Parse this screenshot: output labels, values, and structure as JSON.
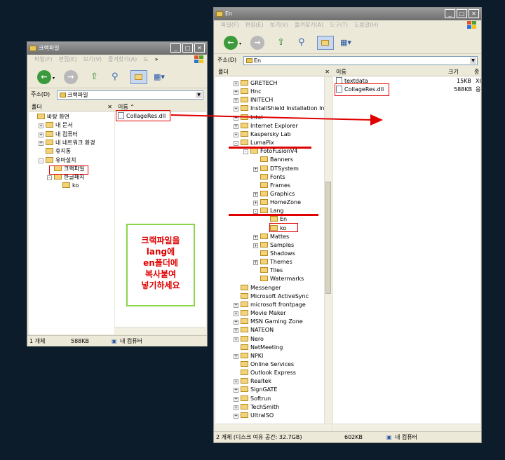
{
  "left_window": {
    "title": "크랙파일",
    "menu": [
      "파일(F)",
      "편집(E)",
      "보기(V)",
      "즐겨찾기(A)",
      "도"
    ],
    "menu_more": "»",
    "address_label": "주소(D)",
    "address_value": "크랙파일",
    "folders_header": "폴더",
    "list_header": "이름",
    "tree": [
      {
        "label": "바탕 화면",
        "indent": 0,
        "pm": ""
      },
      {
        "label": "내 문서",
        "indent": 1,
        "pm": "+"
      },
      {
        "label": "내 컴퓨터",
        "indent": 1,
        "pm": "+"
      },
      {
        "label": "내 네트워크 환경",
        "indent": 1,
        "pm": "+"
      },
      {
        "label": "휴지통",
        "indent": 1,
        "pm": ""
      },
      {
        "label": "유마설치",
        "indent": 1,
        "pm": "-"
      },
      {
        "label": "크랙파일",
        "indent": 2,
        "pm": ""
      },
      {
        "label": "한글패치",
        "indent": 2,
        "pm": "-"
      },
      {
        "label": "ko",
        "indent": 3,
        "pm": ""
      }
    ],
    "file": "CollageRes.dll",
    "status_count": "1 개체",
    "status_size": "588KB",
    "status_location": "내 컴퓨터",
    "note": "크랙파일을\nlang에\nen폴더에\n복사붙여\n넣기하세요"
  },
  "right_window": {
    "title": "En",
    "menu": [
      "파일(F)",
      "편집(E)",
      "보기(V)",
      "즐겨찾기(A)",
      "도구(T)",
      "도움말(H)"
    ],
    "address_label": "주소(D)",
    "address_value": "En",
    "folders_header": "폴더",
    "col_name": "이름",
    "col_size": "크기",
    "col_type": "종",
    "files": [
      {
        "name": "textdata",
        "size": "15KB",
        "type": "XM"
      },
      {
        "name": "CollageRes.dll",
        "size": "588KB",
        "type": "응"
      }
    ],
    "tree": [
      {
        "label": "GRETECH",
        "indent": 0,
        "pm": "+"
      },
      {
        "label": "Hnc",
        "indent": 0,
        "pm": "+"
      },
      {
        "label": "INITECH",
        "indent": 0,
        "pm": "+"
      },
      {
        "label": "InstallShield Installation Inform",
        "indent": 0,
        "pm": "+"
      },
      {
        "label": "Intel",
        "indent": 0,
        "pm": "+"
      },
      {
        "label": "Internet Explorer",
        "indent": 0,
        "pm": "+"
      },
      {
        "label": "Kaspersky Lab",
        "indent": 0,
        "pm": "+"
      },
      {
        "label": "LumaPix",
        "indent": 0,
        "pm": "-"
      },
      {
        "label": "FotoFusionV4",
        "indent": 1,
        "pm": "-"
      },
      {
        "label": "Banners",
        "indent": 2,
        "pm": ""
      },
      {
        "label": "DTSystem",
        "indent": 2,
        "pm": "+"
      },
      {
        "label": "Fonts",
        "indent": 2,
        "pm": ""
      },
      {
        "label": "Frames",
        "indent": 2,
        "pm": ""
      },
      {
        "label": "Graphics",
        "indent": 2,
        "pm": "+"
      },
      {
        "label": "HomeZone",
        "indent": 2,
        "pm": "+"
      },
      {
        "label": "Lang",
        "indent": 2,
        "pm": "-"
      },
      {
        "label": "En",
        "indent": 3,
        "pm": ""
      },
      {
        "label": "ko",
        "indent": 3,
        "pm": ""
      },
      {
        "label": "Mattes",
        "indent": 2,
        "pm": "+"
      },
      {
        "label": "Samples",
        "indent": 2,
        "pm": "+"
      },
      {
        "label": "Shadows",
        "indent": 2,
        "pm": ""
      },
      {
        "label": "Themes",
        "indent": 2,
        "pm": "+"
      },
      {
        "label": "Tiles",
        "indent": 2,
        "pm": ""
      },
      {
        "label": "Watermarks",
        "indent": 2,
        "pm": ""
      },
      {
        "label": "Messenger",
        "indent": 0,
        "pm": ""
      },
      {
        "label": "Microsoft ActiveSync",
        "indent": 0,
        "pm": ""
      },
      {
        "label": "microsoft frontpage",
        "indent": 0,
        "pm": "+"
      },
      {
        "label": "Movie Maker",
        "indent": 0,
        "pm": "+"
      },
      {
        "label": "MSN Gaming Zone",
        "indent": 0,
        "pm": "+"
      },
      {
        "label": "NATEON",
        "indent": 0,
        "pm": "+"
      },
      {
        "label": "Nero",
        "indent": 0,
        "pm": "+"
      },
      {
        "label": "NetMeeting",
        "indent": 0,
        "pm": ""
      },
      {
        "label": "NPKI",
        "indent": 0,
        "pm": "+"
      },
      {
        "label": "Online Services",
        "indent": 0,
        "pm": ""
      },
      {
        "label": "Outlook Express",
        "indent": 0,
        "pm": ""
      },
      {
        "label": "Realtek",
        "indent": 0,
        "pm": "+"
      },
      {
        "label": "SignGATE",
        "indent": 0,
        "pm": "+"
      },
      {
        "label": "Softrun",
        "indent": 0,
        "pm": "+"
      },
      {
        "label": "TechSmith",
        "indent": 0,
        "pm": "+"
      },
      {
        "label": "UltraISO",
        "indent": 0,
        "pm": "+"
      }
    ],
    "status_count": "2 개체 (디스크 여유 공간: 32.7GB)",
    "status_size": "602KB",
    "status_location": "내 컴퓨터"
  },
  "colors": {
    "annotation": "#e00000",
    "note_border": "#8ad64a",
    "background": "#0d1c2a"
  }
}
